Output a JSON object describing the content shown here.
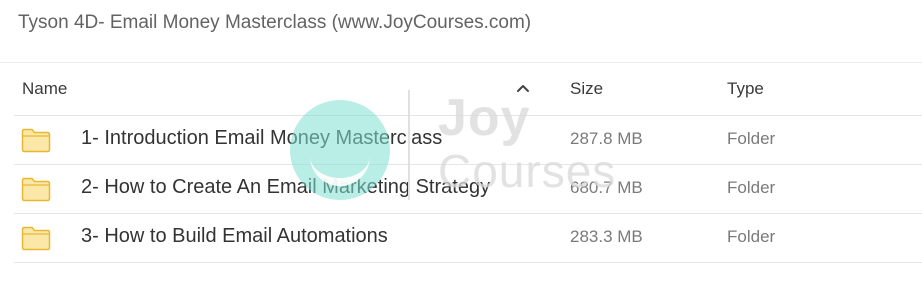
{
  "page": {
    "title": "Tyson 4D- Email Money Masterclass (www.JoyCourses.com)"
  },
  "table": {
    "columns": {
      "name": "Name",
      "size": "Size",
      "type": "Type"
    },
    "sort_icon": "chevron-up-icon",
    "rows": [
      {
        "name": "1- Introduction Email Money Masterclass",
        "size": "287.8 MB",
        "type": "Folder",
        "icon": "folder-icon"
      },
      {
        "name": "2- How to Create An Email Marketing Strategy",
        "size": "680.7 MB",
        "type": "Folder",
        "icon": "folder-icon"
      },
      {
        "name": "3- How to Build Email Automations",
        "size": "283.3 MB",
        "type": "Folder",
        "icon": "folder-icon"
      }
    ]
  },
  "watermark": {
    "line1": "Joy",
    "line2": "Courses"
  },
  "colors": {
    "folder_fill": "#fbe7a7",
    "folder_stroke": "#e8b833",
    "watermark_accent": "#7fe0d4"
  }
}
